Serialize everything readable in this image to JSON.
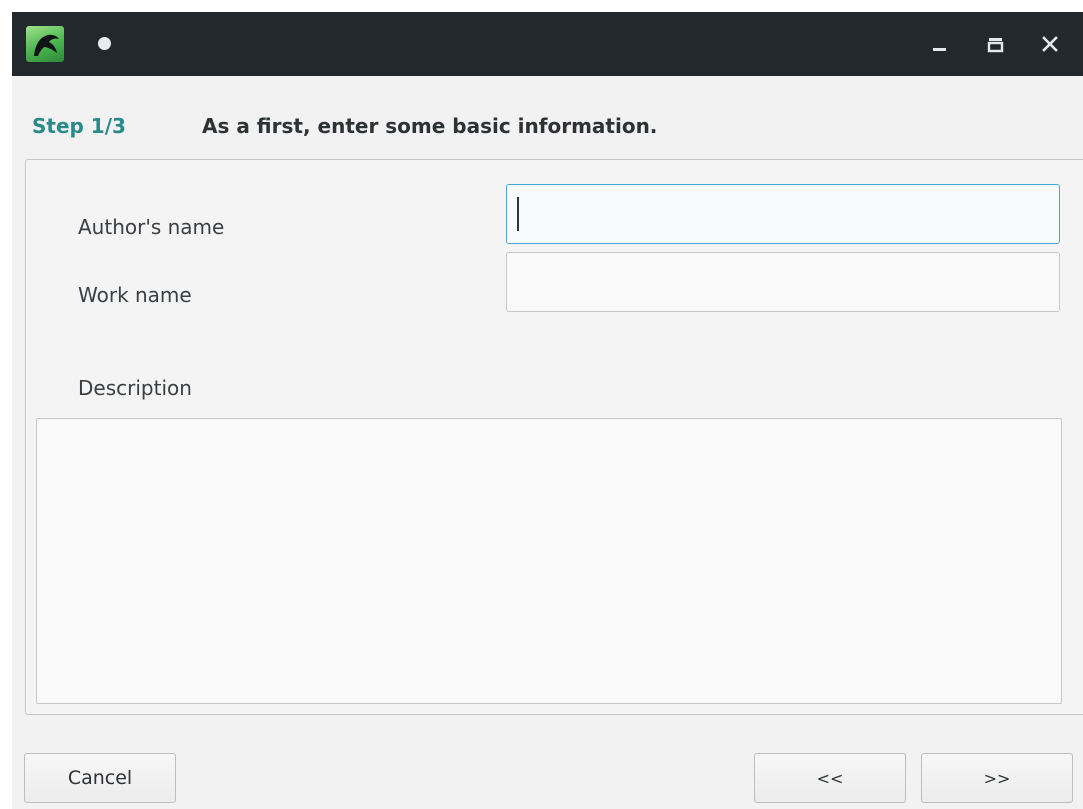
{
  "window": {
    "title_indicator": "●",
    "icons": {
      "app": "app-logo-icon",
      "minimize": "minimize-icon",
      "maximize": "maximize-icon",
      "close": "close-icon"
    }
  },
  "wizard": {
    "step_label": "Step 1/3",
    "heading": "As a first, enter some basic information."
  },
  "form": {
    "author_label": "Author's name",
    "author_value": "",
    "work_label": "Work name",
    "work_value": "",
    "description_label": "Description",
    "description_value": ""
  },
  "buttons": {
    "cancel": "Cancel",
    "back": "<<",
    "next": ">>"
  },
  "colors": {
    "titlebar": "#22292e",
    "step_accent": "#2a8a8a",
    "focus_border": "#4ea6d8"
  }
}
